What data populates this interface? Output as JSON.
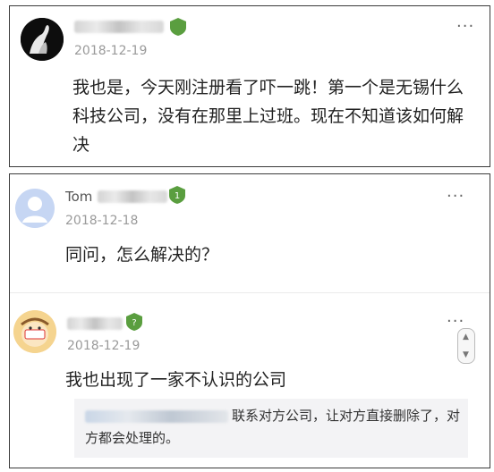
{
  "comment1": {
    "date": "2018-12-19",
    "text": "我也是，今天刚注册看了吓一跳！第一个是无锡什么科技公司，没有在那里上过班。现在不知道该如何解决",
    "more": "···",
    "badge_color": "#5a9e3f"
  },
  "comment2": {
    "name_visible": "Tom",
    "date": "2018-12-18",
    "text": "同问，怎么解决的？",
    "more": "···",
    "badge_level": "1",
    "badge_color": "#5a9e3f"
  },
  "comment3": {
    "date": "2018-12-19",
    "text": "我也出现了一家不认识的公司",
    "more": "···",
    "badge_level": "?",
    "badge_color": "#5a9e3f",
    "reply_text": "联系对方公司，让对方直接删除了，对方都会处理的。"
  }
}
